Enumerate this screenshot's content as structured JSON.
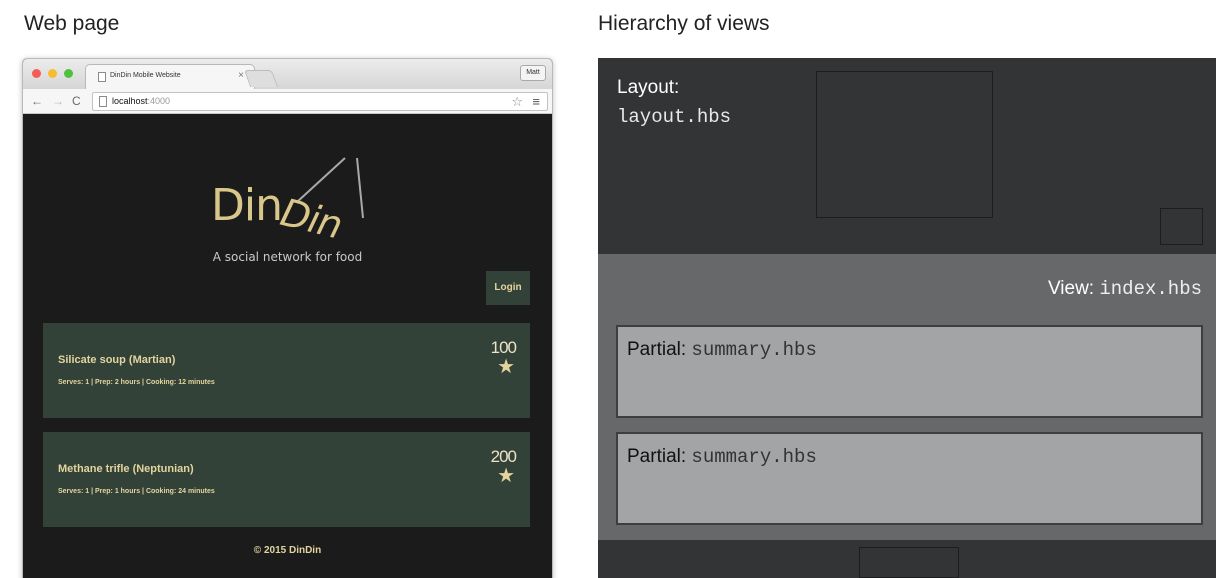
{
  "headings": {
    "left": "Web page",
    "right": "Hierarchy of views"
  },
  "browser": {
    "tab_title": "DinDin Mobile Website",
    "tab_close": "×",
    "profile_label": "Matt",
    "nav_back": "←",
    "nav_forward": "→",
    "nav_reload": "C",
    "url_host": "localhost",
    "url_port": ":4000",
    "bookmark_icon": "star-outline-icon",
    "menu_icon": "hamburger-menu-icon"
  },
  "site": {
    "logo_part1": "Din",
    "logo_part2": "Din",
    "tagline": "A social network for food",
    "login_label": "Login",
    "recipes": [
      {
        "title": "Silicate soup (Martian)",
        "meta": "Serves: 1 | Prep: 2 hours | Cooking: 12 minutes",
        "score": "100",
        "star": "★"
      },
      {
        "title": "Methane trifle (Neptunian)",
        "meta": "Serves: 1 | Prep: 1 hours | Cooking: 24 minutes",
        "score": "200",
        "star": "★"
      }
    ],
    "footer": "© 2015 DinDin",
    "colors": {
      "page_bg": "#1b1b1c",
      "card_bg": "#334238",
      "accent": "#e3d49e"
    }
  },
  "hierarchy": {
    "layout_label": "Layout:",
    "layout_file": "layout.hbs",
    "view_label": "View:",
    "view_file": "index.hbs",
    "partials": [
      {
        "label": "Partial:",
        "file": "summary.hbs"
      },
      {
        "label": "Partial:",
        "file": "summary.hbs"
      }
    ],
    "colors": {
      "layout_bg": "#333436",
      "view_bg": "#67686a",
      "partial_bg": "#a3a4a6"
    }
  }
}
